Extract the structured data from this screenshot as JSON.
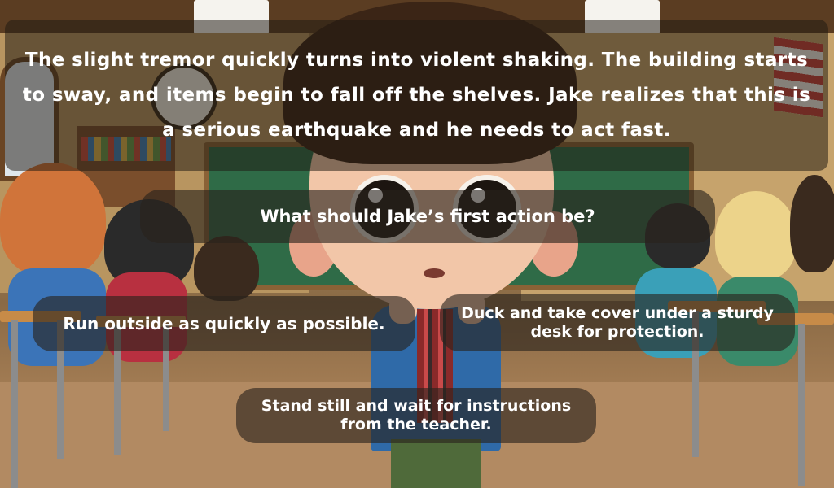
{
  "story": {
    "narration": "The slight tremor quickly turns into violent shaking. The building starts to sway, and items begin to fall off the shelves. Jake realizes that this is a serious earthquake and he needs to act fast."
  },
  "question": {
    "text": "What should Jake’s first action be?"
  },
  "options": [
    {
      "text": "Run outside as quickly as possible."
    },
    {
      "text": "Duck and take cover under a sturdy desk for protection."
    },
    {
      "text": "Stand still and wait for instructions from the teacher."
    }
  ],
  "colors": {
    "overlay": "#1e1812",
    "text": "#ffffff"
  }
}
